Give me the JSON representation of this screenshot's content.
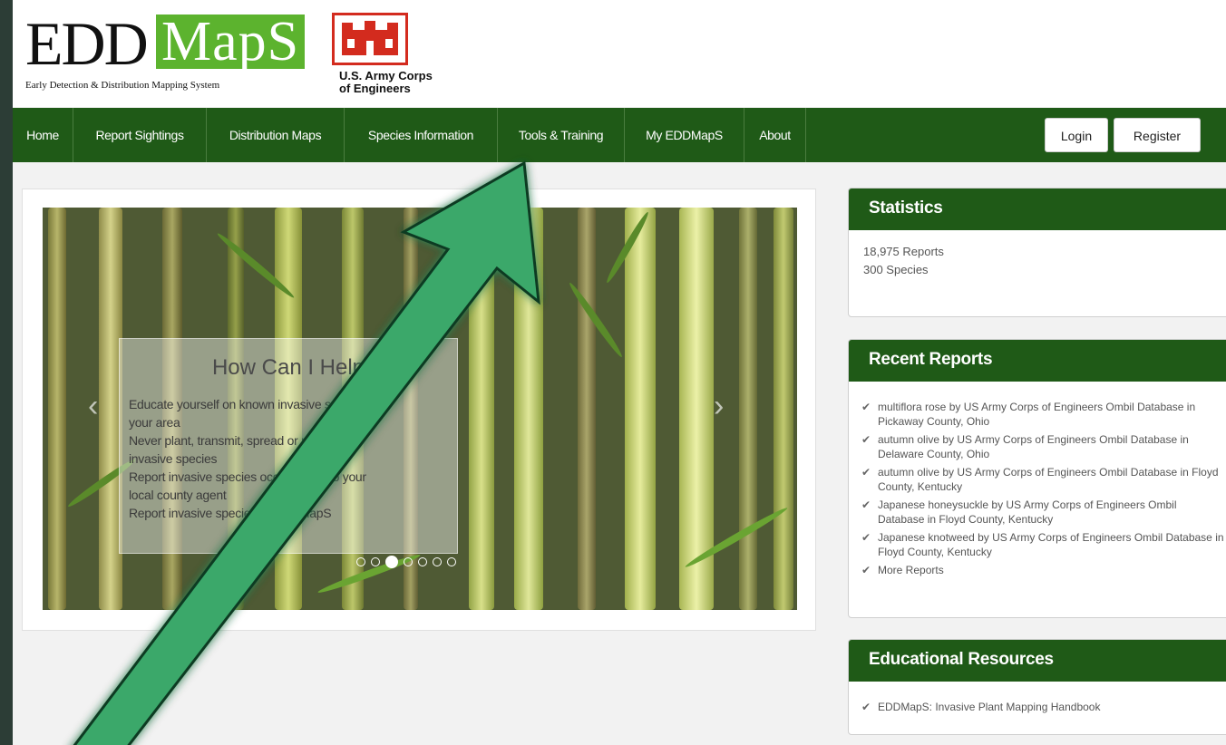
{
  "header": {
    "logo_edd": "EDD",
    "logo_maps": "MapS",
    "tagline": "Early Detection & Distribution Mapping System",
    "partner_line1": "U.S. Army Corps",
    "partner_line2": "of Engineers"
  },
  "nav": {
    "items": [
      {
        "label": "Home"
      },
      {
        "label": "Report Sightings"
      },
      {
        "label": "Distribution Maps"
      },
      {
        "label": "Species Information"
      },
      {
        "label": "Tools & Training"
      },
      {
        "label": "My EDDMapS"
      },
      {
        "label": "About"
      }
    ],
    "login": "Login",
    "register": "Register"
  },
  "carousel": {
    "caption_title": "How Can I Help",
    "lines": [
      "Educate yourself on known invasive species in",
      "your area",
      "Never plant, transmit, spread or release",
      "invasive species",
      "Report invasive species occurrences to your",
      "local county agent",
      "Report invasive species to EDDMapS"
    ],
    "slide_count": 7,
    "active_slide": 3,
    "prev_icon": "chevron-left-icon",
    "next_icon": "chevron-right-icon"
  },
  "statistics": {
    "title": "Statistics",
    "reports": "18,975 Reports",
    "species": "300 Species"
  },
  "recent_reports": {
    "title": "Recent Reports",
    "items": [
      "multiflora rose by US Army Corps of Engineers Ombil Database in Pickaway County, Ohio",
      "autumn olive by US Army Corps of Engineers Ombil Database in Delaware County, Ohio",
      "autumn olive by US Army Corps of Engineers Ombil Database in Floyd County, Kentucky",
      "Japanese honeysuckle by US Army Corps of Engineers Ombil Database in Floyd County, Kentucky",
      "Japanese knotweed by US Army Corps of Engineers Ombil Database in Floyd County, Kentucky",
      "More Reports"
    ],
    "check": "✔"
  },
  "educational": {
    "title": "Educational Resources",
    "items": [
      "EDDMapS: Invasive Plant Mapping Handbook"
    ],
    "check": "✔"
  },
  "colors": {
    "nav_green": "#1f5a17",
    "maps_green": "#5cb32e",
    "arrow_green": "#3aa86b",
    "usace_red": "#d32b1e"
  }
}
